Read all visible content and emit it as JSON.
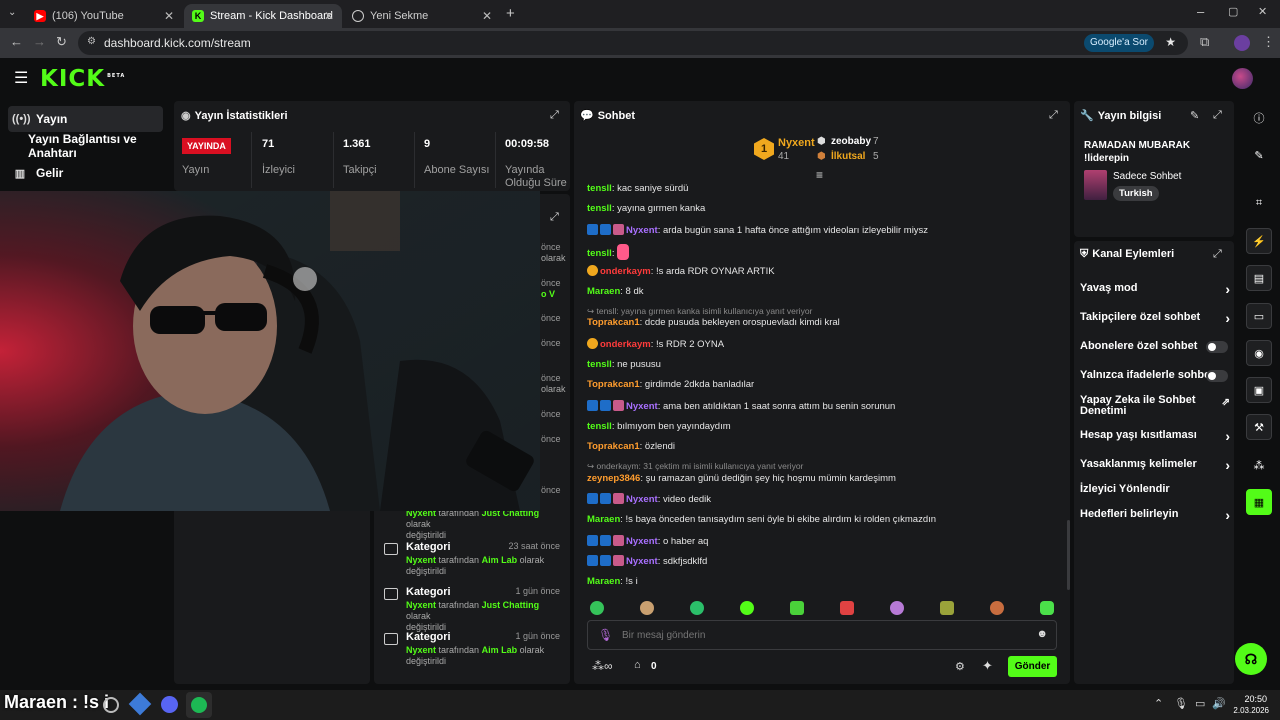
{
  "browser": {
    "tabs": [
      {
        "title": "(106) YouTube"
      },
      {
        "title": "Stream - Kick Dashboard"
      },
      {
        "title": "Yeni Sekme"
      }
    ],
    "url": "dashboard.kick.com/stream",
    "google_chip": "Google'a Sor"
  },
  "header": {
    "logo": "KICK",
    "beta": "BETA"
  },
  "sidebar": {
    "items": [
      {
        "label": "Yayın",
        "icon": "broadcast-icon"
      },
      {
        "label": "Yayın Bağlantısı ve Anahtarı",
        "icon": ""
      },
      {
        "label": "Gelir",
        "icon": "revenue-icon"
      }
    ]
  },
  "stats": {
    "title": "Yayın İstatistikleri",
    "live_badge": "YAYINDA",
    "items": [
      {
        "value": "",
        "label": "Yayın"
      },
      {
        "value": "71",
        "label": "İzleyici"
      },
      {
        "value": "1.361",
        "label": "Takipçi"
      },
      {
        "value": "9",
        "label": "Abone Sayısı"
      },
      {
        "value": "00:09:58",
        "label": "Yayında Olduğu Süre"
      }
    ]
  },
  "activity": {
    "partial_times": [
      "önce",
      "önce",
      "önce",
      "önce",
      "önce",
      "önce",
      "önce",
      "önce"
    ],
    "partial_texts": [
      "olarak",
      "o V",
      "olarak"
    ],
    "items": [
      {
        "title": "",
        "time": "",
        "by": "Nyxent",
        "mid": "tarafından",
        "game": "Just Chatting",
        "tail": "olarak",
        "tail2": "değiştirildi"
      },
      {
        "title": "Kategori",
        "time": "23 saat önce",
        "by": "Nyxent",
        "mid": "tarafından",
        "game": "Aim Lab",
        "tail": "olarak",
        "tail2": "değiştirildi"
      },
      {
        "title": "Kategori",
        "time": "1 gün önce",
        "by": "Nyxent",
        "mid": "tarafından",
        "game": "Just Chatting",
        "tail": "olarak",
        "tail2": "değiştirildi"
      },
      {
        "title": "Kategori",
        "time": "1 gün önce",
        "by": "Nyxent",
        "mid": "tarafından",
        "game": "Aim Lab",
        "tail": "olarak",
        "tail2": "değiştirildi"
      }
    ]
  },
  "chat": {
    "title": "Sohbet",
    "leaderboard": {
      "first": {
        "rank": "1",
        "name": "Nyxent",
        "count": "41"
      },
      "second": {
        "name": "zeobaby",
        "count": "7"
      },
      "third": {
        "name": "İlkutsal",
        "count": "5"
      }
    },
    "messages": [
      {
        "user": "tensll",
        "color": "#53fc18",
        "text": "kac saniye sürdü"
      },
      {
        "user": "tensll",
        "color": "#53fc18",
        "text": "yayına gırmen kanka"
      },
      {
        "user": "Nyxent",
        "color": "#a970ff",
        "text": "arda bugün sana 1 hafta önce attığım videoları izleyebilir miysz"
      },
      {
        "user": "tensll",
        "color": "#53fc18",
        "text": ""
      },
      {
        "user": "onderkaym",
        "color": "#ff3b3b",
        "text": "!s arda RDR OYNAR ARTIK"
      },
      {
        "user": "Maraen",
        "color": "#53fc18",
        "text": "8 dk"
      },
      {
        "reply": "tensll: yayına gırmen kanka isimli kullanıcıya yanıt veriyor"
      },
      {
        "user": "Toprakcan1",
        "color": "#ff9d2e",
        "text": "dcde pusuda bekleyen orospuevladı kimdi kral"
      },
      {
        "user": "onderkaym",
        "color": "#ff3b3b",
        "text": "!s RDR 2 OYNA"
      },
      {
        "user": "tensll",
        "color": "#53fc18",
        "text": "ne pususu"
      },
      {
        "user": "Toprakcan1",
        "color": "#ff9d2e",
        "text": "girdimde 2dkda banladılar"
      },
      {
        "user": "Nyxent",
        "color": "#a970ff",
        "text": "ama ben atıldıktan 1 saat sonra attım bu senin sorunun"
      },
      {
        "user": "tensll",
        "color": "#53fc18",
        "text": "bılmıyom ben yayındaydım"
      },
      {
        "user": "Toprakcan1",
        "color": "#ff9d2e",
        "text": "özlendi"
      },
      {
        "reply": "onderkaym: 31 çektim mi isimli kullanıcıya yanıt veriyor"
      },
      {
        "user": "zeynep3846",
        "color": "#ff9d2e",
        "text": "şu ramazan günü dediğin şey hiç hoşmu mümin kardeşimm"
      },
      {
        "user": "Nyxent",
        "color": "#a970ff",
        "text": "video dedik"
      },
      {
        "user": "Maraen",
        "color": "#53fc18",
        "text": "!s baya önceden tanısaydım seni öyle bi ekibe alırdım ki rolden çıkmazdın"
      },
      {
        "user": "Nyxent",
        "color": "#a970ff",
        "text": "o haber aq"
      },
      {
        "user": "Nyxent",
        "color": "#a970ff",
        "text": "sdkfjsdklfd"
      },
      {
        "user": "Maraen",
        "color": "#53fc18",
        "text": "!s i"
      }
    ],
    "placeholder": "Bir mesaj gönderin",
    "points": "0",
    "send_label": "Gönder"
  },
  "stream_info": {
    "title": "Yayın bilgisi",
    "stream_title": "RAMADAN MUBARAK !liderepin",
    "category": "Sadece Sohbet",
    "language": "Turkish"
  },
  "channel_actions": {
    "title": "Kanal Eylemleri",
    "items": [
      {
        "label": "Yavaş mod",
        "control": "chevron"
      },
      {
        "label": "Takipçilere özel sohbet",
        "control": "chevron"
      },
      {
        "label": "Abonelere özel sohbet",
        "control": "toggle"
      },
      {
        "label": "Yalnızca ifadelerle sohbet",
        "control": "toggle"
      },
      {
        "label": "Yapay Zeka ile Sohbet Denetimi",
        "control": "external"
      },
      {
        "label": "Hesap yaşı kısıtlaması",
        "control": "chevron"
      },
      {
        "label": "Yasaklanmış kelimeler",
        "control": "chevron"
      },
      {
        "label": "İzleyici Yönlendir",
        "control": "none"
      },
      {
        "label": "Hedefleri belirleyin",
        "control": "chevron"
      }
    ]
  },
  "overlay_caption": "Maraen : !s i",
  "taskbar": {
    "time": "20:50",
    "date": "2.03.2026"
  },
  "colors": {
    "accent": "#53fc18",
    "live": "#d90f21",
    "panel": "#191a1c"
  }
}
